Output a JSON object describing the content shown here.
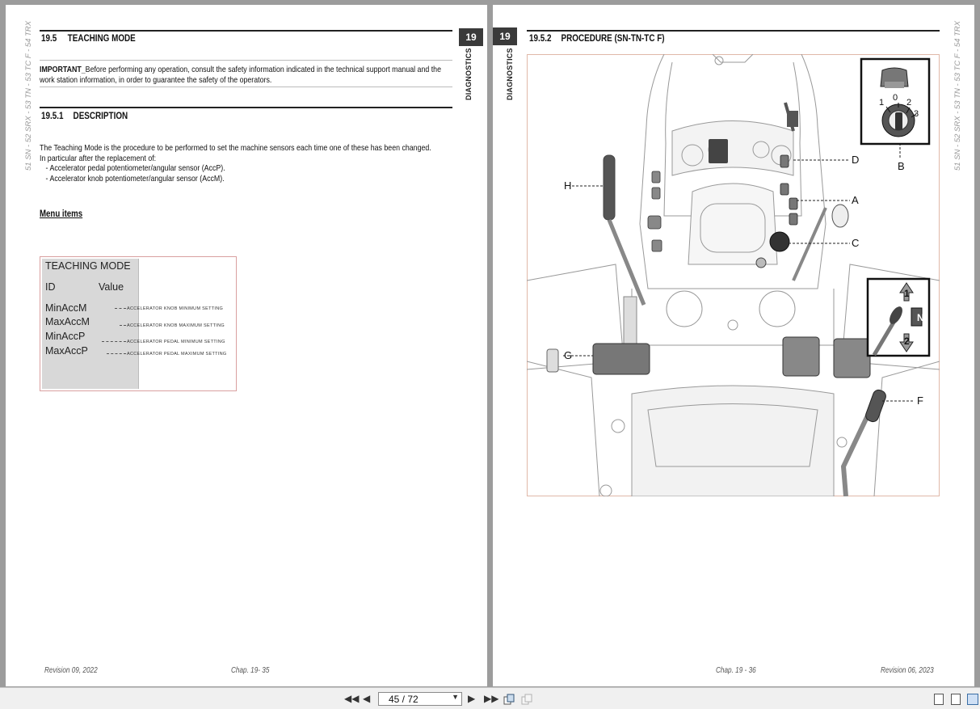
{
  "left_page": {
    "side_text": "51 SN - 52 SRX - 53 TN - 53 TC F - 54 TRX",
    "chapter_tab": "19",
    "chapter_vertical": "DIAGNOSTICS",
    "section": {
      "number": "19.5",
      "title": "TEACHING MODE"
    },
    "important": {
      "label": "IMPORTANT_",
      "line1": "Before performing any operation, consult the safety information indicated in the technical support manual and the",
      "line2": "work station information, in order to guarantee the safety of the operators."
    },
    "subsection": {
      "number": "19.5.1",
      "title": "DESCRIPTION"
    },
    "description": [
      "The Teaching Mode is the procedure to be performed to set the machine sensors each time one of these has been changed.",
      "In particular after the replacement of:",
      "- Accelerator pedal potentiometer/angular sensor (AccP).",
      "- Accelerator knob potentiometer/angular sensor (AccM)."
    ],
    "menu_heading": "Menu items",
    "menu": {
      "title": "TEACHING MODE",
      "col_id": "ID",
      "col_value": "Value",
      "items": [
        {
          "id": "MinAccM",
          "desc": "ACCELERATOR KNOB MINIMUM SETTING"
        },
        {
          "id": "MaxAccM",
          "desc": "ACCELERATOR KNOB MAXIMUM SETTING"
        },
        {
          "id": "MinAccP",
          "desc": "ACCELERATOR PEDAL MINIMUM SETTING"
        },
        {
          "id": "MaxAccP",
          "desc": "ACCELERATOR PEDAL MAXIMUM SETTING"
        }
      ]
    },
    "footer_left": "Revision 09, 2022",
    "footer_center": "Chap. 19- 35"
  },
  "right_page": {
    "side_text": "51 SN - 52 SRX - 53 TN - 53 TC F - 54 TRX",
    "chapter_tab": "19",
    "chapter_vertical": "DIAGNOSTICS",
    "subsection": {
      "number": "19.5.2",
      "title": "PROCEDURE (SN-TN-TC F)"
    },
    "figure_labels": {
      "a": "A",
      "b": "B",
      "c": "C",
      "d": "D",
      "f": "F",
      "g": "G",
      "h": "H",
      "key_pos_1": "1",
      "key_pos_0": "0",
      "key_pos_2": "2",
      "key_pos_3": "3",
      "gear_up": "1",
      "gear_neutral": "N",
      "gear_down": "2"
    },
    "footer_center": "Chap. 19 - 36",
    "footer_right": "Revision 06, 2023"
  },
  "toolbar": {
    "first_icon": "first-page-icon",
    "prev_icon": "previous-page-icon",
    "page_value": "45 / 72",
    "dropdown_icon": "dropdown-arrow-icon",
    "next_icon": "next-page-icon",
    "last_icon": "last-page-icon"
  }
}
